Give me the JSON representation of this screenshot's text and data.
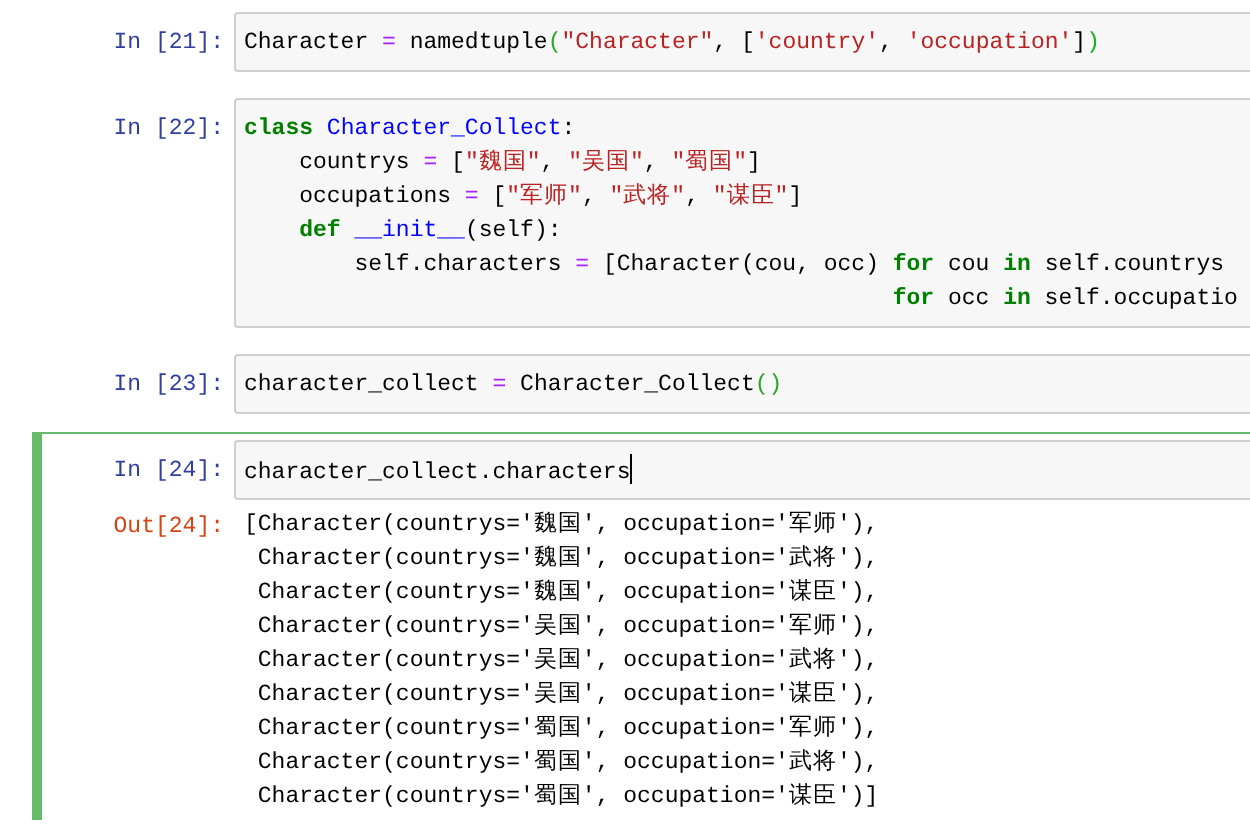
{
  "cells": [
    {
      "prompt": "In [21]:",
      "selected": false,
      "has_cursor": false,
      "lines": [
        [
          {
            "t": "Character ",
            "kind": "plain"
          },
          {
            "t": "=",
            "kind": "operator"
          },
          {
            "t": " namedtuple",
            "kind": "plain"
          },
          {
            "t": "(",
            "kind": "bracket"
          },
          {
            "t": "\"Character\"",
            "kind": "string"
          },
          {
            "t": ", [",
            "kind": "plain"
          },
          {
            "t": "'country'",
            "kind": "string"
          },
          {
            "t": ", ",
            "kind": "plain"
          },
          {
            "t": "'occupation'",
            "kind": "string"
          },
          {
            "t": "]",
            "kind": "plain"
          },
          {
            "t": ")",
            "kind": "bracket"
          }
        ]
      ]
    },
    {
      "prompt": "In [22]:",
      "selected": false,
      "has_cursor": false,
      "lines": [
        [
          {
            "t": "class",
            "kind": "keyword"
          },
          {
            "t": " Character_Collect",
            "kind": "definition"
          },
          {
            "t": ":",
            "kind": "plain"
          }
        ],
        [
          {
            "t": "    countrys ",
            "kind": "plain"
          },
          {
            "t": "=",
            "kind": "operator"
          },
          {
            "t": " [",
            "kind": "plain"
          },
          {
            "t": "\"魏国\"",
            "kind": "string"
          },
          {
            "t": ", ",
            "kind": "plain"
          },
          {
            "t": "\"吴国\"",
            "kind": "string"
          },
          {
            "t": ", ",
            "kind": "plain"
          },
          {
            "t": "\"蜀国\"",
            "kind": "string"
          },
          {
            "t": "]",
            "kind": "plain"
          }
        ],
        [
          {
            "t": "    occupations ",
            "kind": "plain"
          },
          {
            "t": "=",
            "kind": "operator"
          },
          {
            "t": " [",
            "kind": "plain"
          },
          {
            "t": "\"军师\"",
            "kind": "string"
          },
          {
            "t": ", ",
            "kind": "plain"
          },
          {
            "t": "\"武将\"",
            "kind": "string"
          },
          {
            "t": ", ",
            "kind": "plain"
          },
          {
            "t": "\"谋臣\"",
            "kind": "string"
          },
          {
            "t": "]",
            "kind": "plain"
          }
        ],
        [
          {
            "t": "    def",
            "kind": "keyword"
          },
          {
            "t": " __init__",
            "kind": "definition"
          },
          {
            "t": "(self):",
            "kind": "plain"
          }
        ],
        [
          {
            "t": "        self.characters ",
            "kind": "plain"
          },
          {
            "t": "=",
            "kind": "operator"
          },
          {
            "t": " [Character(cou, occ) ",
            "kind": "plain"
          },
          {
            "t": "for",
            "kind": "keyword"
          },
          {
            "t": " cou ",
            "kind": "plain"
          },
          {
            "t": "in",
            "kind": "keyword"
          },
          {
            "t": " self.countrys",
            "kind": "plain"
          }
        ],
        [
          {
            "t": "                                               for",
            "kind": "keyword"
          },
          {
            "t": " occ ",
            "kind": "plain"
          },
          {
            "t": "in",
            "kind": "keyword"
          },
          {
            "t": " self.occupatio",
            "kind": "plain"
          }
        ]
      ]
    },
    {
      "prompt": "In [23]:",
      "selected": false,
      "has_cursor": false,
      "lines": [
        [
          {
            "t": "character_collect ",
            "kind": "plain"
          },
          {
            "t": "=",
            "kind": "operator"
          },
          {
            "t": " Character_Collect",
            "kind": "plain"
          },
          {
            "t": "()",
            "kind": "bracket"
          }
        ]
      ]
    },
    {
      "prompt": "In [24]:",
      "selected": true,
      "has_cursor": true,
      "lines": [
        [
          {
            "t": "character_collect.characters",
            "kind": "plain"
          }
        ]
      ],
      "output": {
        "prompt": "Out[24]:",
        "lines": [
          "[Character(countrys='魏国', occupation='军师'),",
          " Character(countrys='魏国', occupation='武将'),",
          " Character(countrys='魏国', occupation='谋臣'),",
          " Character(countrys='吴国', occupation='军师'),",
          " Character(countrys='吴国', occupation='武将'),",
          " Character(countrys='吴国', occupation='谋臣'),",
          " Character(countrys='蜀国', occupation='军师'),",
          " Character(countrys='蜀国', occupation='武将'),",
          " Character(countrys='蜀国', occupation='谋臣')]"
        ]
      }
    }
  ]
}
